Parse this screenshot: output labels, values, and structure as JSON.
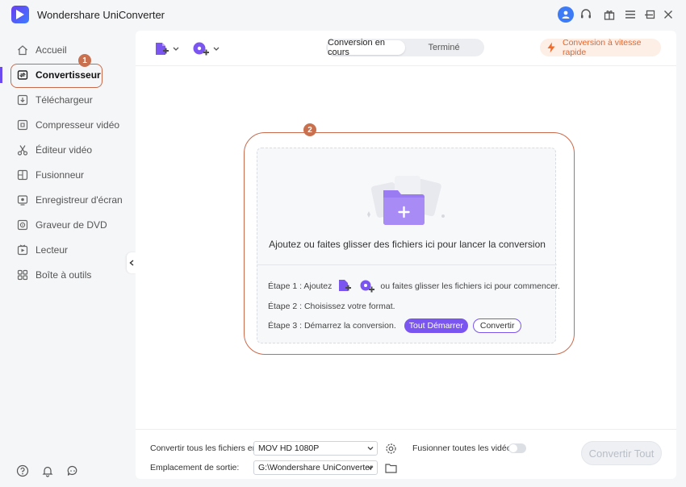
{
  "app": {
    "title": "Wondershare UniConverter"
  },
  "sidebar": {
    "items": [
      {
        "label": "Accueil",
        "icon": "home-icon"
      },
      {
        "label": "Convertisseur",
        "icon": "convert-icon",
        "active": true
      },
      {
        "label": "Téléchargeur",
        "icon": "download-icon"
      },
      {
        "label": "Compresseur vidéo",
        "icon": "compress-icon"
      },
      {
        "label": "Éditeur vidéo",
        "icon": "scissors-icon"
      },
      {
        "label": "Fusionneur",
        "icon": "merge-icon"
      },
      {
        "label": "Enregistreur d'écran",
        "icon": "record-icon"
      },
      {
        "label": "Graveur de DVD",
        "icon": "dvd-icon"
      },
      {
        "label": "Lecteur",
        "icon": "player-icon"
      },
      {
        "label": "Boîte à outils",
        "icon": "toolbox-icon"
      }
    ],
    "callout_number": "1"
  },
  "tabs": {
    "in_progress": "Conversion en cours",
    "done": "Terminé"
  },
  "speed_button": "Conversion à vitesse rapide",
  "dropzone": {
    "callout_number": "2",
    "headline": "Ajoutez ou faites glisser des fichiers ici pour lancer la conversion",
    "step1_prefix": "Étape 1 : Ajoutez",
    "step1_suffix": "ou faites glisser les fichiers ici pour commencer.",
    "step2": "Étape 2 : Choisissez votre format.",
    "step3": "Étape 3 : Démarrez la conversion.",
    "start_all": "Tout Démarrer",
    "convert": "Convertir"
  },
  "footer": {
    "convert_all_label": "Convertir tous les fichiers en:",
    "format_value": "MOV HD 1080P",
    "merge_label": "Fusionner toutes les vidéos",
    "output_label": "Emplacement de sortie:",
    "output_value": "G:\\Wondershare UniConverter",
    "convert_all_button": "Convertir Tout"
  },
  "colors": {
    "accent": "#7b55f0",
    "callout": "#c96a4c",
    "speed": "#e5652a"
  }
}
